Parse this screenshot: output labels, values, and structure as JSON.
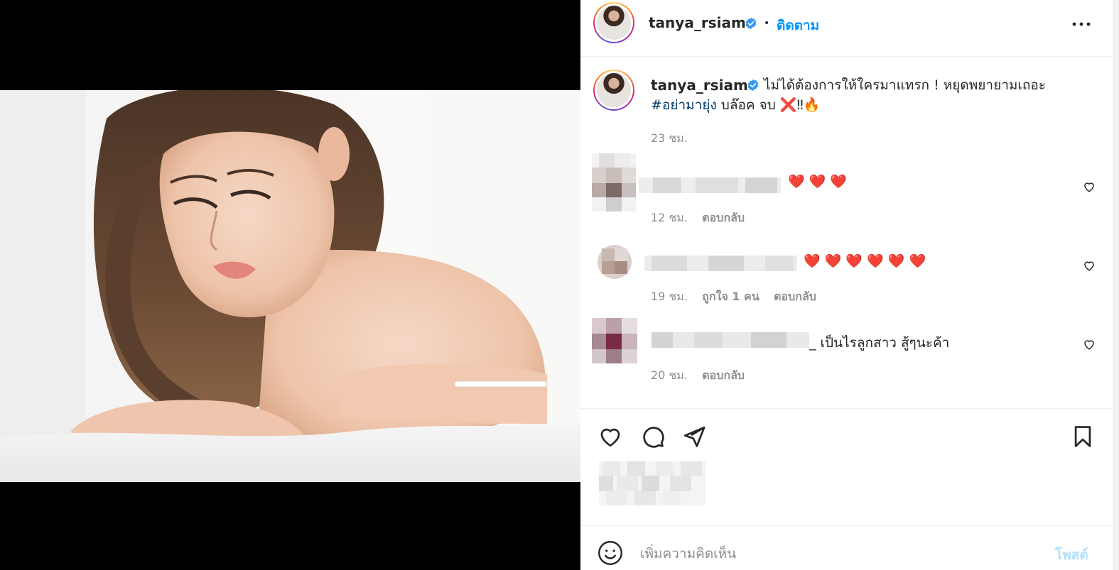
{
  "post": {
    "username": "tanya_rsiam",
    "dot": "•",
    "follow_label": "ติดตาม",
    "caption": {
      "username": "tanya_rsiam",
      "line1": "ไม่ได้ต้องการให้ใครมาแทรก ! หยุดพยายามเถอะ",
      "hashtag": "#อย่ามายุ่ง",
      "line2_rest": " บล๊อค จบ ❌‼🔥",
      "time": "23 ชม."
    },
    "comments": [
      {
        "text": "❤️ ❤️ ❤️",
        "time": "12 ชม.",
        "likes": "",
        "reply": "ตอบกลับ"
      },
      {
        "text": "❤️ ❤️ ❤️ ❤️ ❤️ ❤️",
        "time": "19 ชม.",
        "likes": "ถูกใจ 1 คน",
        "reply": "ตอบกลับ"
      },
      {
        "text": "_ เป็นไรลูกสาว สู้ๆนะค้า",
        "time": "20 ชม.",
        "likes": "",
        "reply": "ตอบกลับ"
      }
    ],
    "comment_placeholder": "เพิ่มความคิดเห็น",
    "post_label": "โพสต์"
  },
  "icons": {
    "verified": "verified-badge-icon",
    "more": "more-options-icon",
    "like": "heart-icon",
    "comment": "comment-bubble-icon",
    "share": "paper-plane-icon",
    "save": "bookmark-icon",
    "emoji": "emoji-smiley-icon"
  },
  "colors": {
    "accent": "#0095f6",
    "hashtag": "#00376b",
    "muted": "#8e8e8e",
    "post_disabled": "#b2dffc"
  }
}
